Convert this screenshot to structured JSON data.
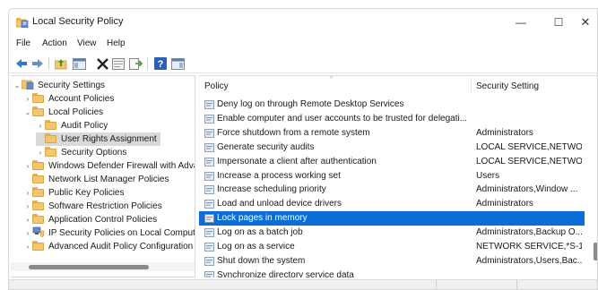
{
  "window": {
    "title": "Local Security Policy",
    "minimize_glyph": "—",
    "maximize_glyph": "☐",
    "close_glyph": "✕"
  },
  "menu": [
    "File",
    "Action",
    "View",
    "Help"
  ],
  "toolbar_icons": [
    "back-icon",
    "forward-icon",
    "up-folder-icon",
    "show-hide-tree-icon",
    "delete-icon",
    "properties-icon",
    "export-list-icon",
    "help-icon",
    "show-action-pane-icon"
  ],
  "tree": [
    {
      "label": "Security Settings",
      "level": 0,
      "arrow": "⌄",
      "icon": "shield-icon"
    },
    {
      "label": "Account Policies",
      "level": 1,
      "arrow": "›",
      "icon": "folder-icon"
    },
    {
      "label": "Local Policies",
      "level": 1,
      "arrow": "⌄",
      "icon": "folder-icon"
    },
    {
      "label": "Audit Policy",
      "level": 2,
      "arrow": "›",
      "icon": "folder-icon"
    },
    {
      "label": "User Rights Assignment",
      "level": 2,
      "arrow": "",
      "icon": "folder-icon",
      "selected": true
    },
    {
      "label": "Security Options",
      "level": 2,
      "arrow": "›",
      "icon": "folder-icon"
    },
    {
      "label": "Windows Defender Firewall with Adva",
      "level": 1,
      "arrow": "›",
      "icon": "folder-icon"
    },
    {
      "label": "Network List Manager Policies",
      "level": 1,
      "arrow": "",
      "icon": "folder-icon"
    },
    {
      "label": "Public Key Policies",
      "level": 1,
      "arrow": "›",
      "icon": "folder-icon"
    },
    {
      "label": "Software Restriction Policies",
      "level": 1,
      "arrow": "›",
      "icon": "folder-icon"
    },
    {
      "label": "Application Control Policies",
      "level": 1,
      "arrow": "›",
      "icon": "folder-icon"
    },
    {
      "label": "IP Security Policies on Local Computer",
      "level": 1,
      "arrow": "›",
      "icon": "ip-security-icon"
    },
    {
      "label": "Advanced Audit Policy Configuration",
      "level": 1,
      "arrow": "›",
      "icon": "folder-icon"
    }
  ],
  "list": {
    "columns": [
      "Policy",
      "Security Setting"
    ],
    "rows": [
      {
        "policy": "Deny log on through Remote Desktop Services",
        "setting": ""
      },
      {
        "policy": "Enable computer and user accounts to be trusted for delegati...",
        "setting": ""
      },
      {
        "policy": "Force shutdown from a remote system",
        "setting": "Administrators"
      },
      {
        "policy": "Generate security audits",
        "setting": "LOCAL SERVICE,NETWOR..."
      },
      {
        "policy": "Impersonate a client after authentication",
        "setting": "LOCAL SERVICE,NETWOR..."
      },
      {
        "policy": "Increase a process working set",
        "setting": "Users"
      },
      {
        "policy": "Increase scheduling priority",
        "setting": "Administrators,Window ..."
      },
      {
        "policy": "Load and unload device drivers",
        "setting": "Administrators"
      },
      {
        "policy": "Lock pages in memory",
        "setting": "",
        "selected": true
      },
      {
        "policy": "Log on as a batch job",
        "setting": "Administrators,Backup O..."
      },
      {
        "policy": "Log on as a service",
        "setting": "NETWORK SERVICE,*S-1-..."
      },
      {
        "policy": "Shut down the system",
        "setting": "Administrators,Users,Bac..."
      },
      {
        "policy": "Synchronize directory service data",
        "setting": ""
      }
    ]
  },
  "colors": {
    "selection": "#0a6ed6",
    "tree_selection": "#d9d9d9",
    "folder": "#f2c66b"
  }
}
